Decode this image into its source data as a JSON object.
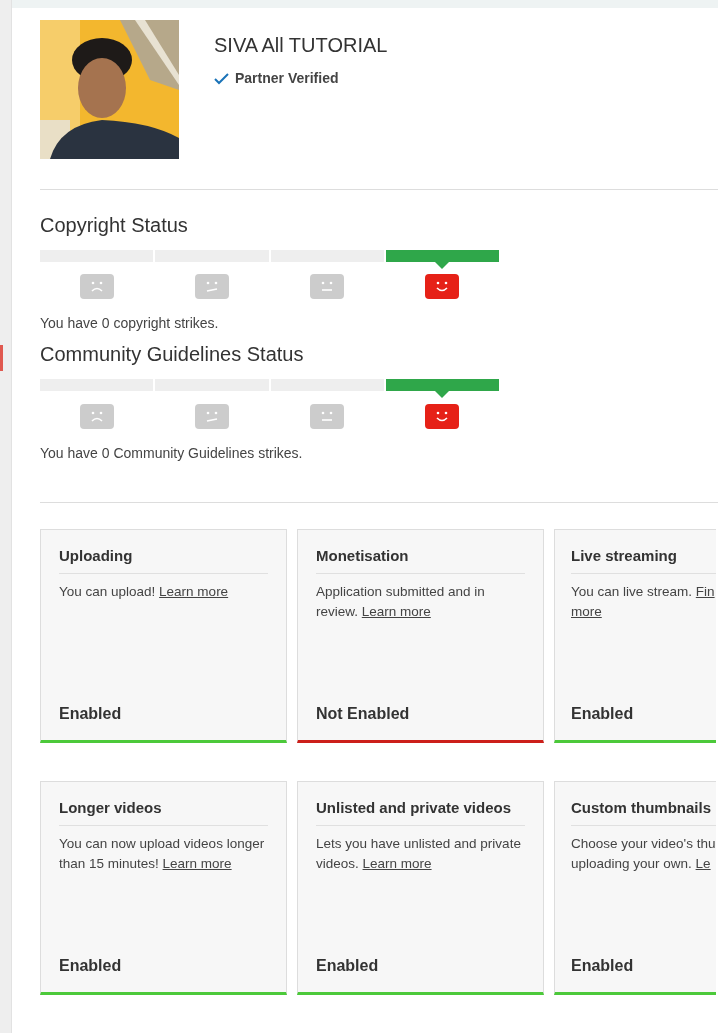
{
  "channel": {
    "name": "SIVA All TUTORIAL",
    "badge": "Partner Verified"
  },
  "statuses": [
    {
      "title": "Copyright Status",
      "segments": [
        {
          "selected": false
        },
        {
          "selected": false
        },
        {
          "selected": false
        },
        {
          "selected": true
        }
      ],
      "message": "You have 0 copyright strikes."
    },
    {
      "title": "Community Guidelines Status",
      "segments": [
        {
          "selected": false
        },
        {
          "selected": false
        },
        {
          "selected": false
        },
        {
          "selected": true
        }
      ],
      "message": "You have 0 Community Guidelines strikes."
    }
  ],
  "features": [
    {
      "title": "Uploading",
      "body": [
        {
          "text": "You can upload! "
        },
        {
          "text": "Learn more",
          "kind": "link"
        }
      ],
      "status": "Enabled",
      "enabled": true
    },
    {
      "title": "Monetisation",
      "body": [
        {
          "text": "Application submitted and in review. "
        },
        {
          "text": "Learn more",
          "kind": "link"
        }
      ],
      "status": "Not Enabled",
      "enabled": false
    },
    {
      "title": "Live streaming",
      "body": [
        {
          "text": "You can live stream. "
        },
        {
          "text": "Fin",
          "kind": "link"
        },
        {
          "kind": "break"
        },
        {
          "text": "more",
          "kind": "link"
        }
      ],
      "status": "Enabled",
      "enabled": true
    },
    {
      "title": "Longer videos",
      "body": [
        {
          "text": "You can now upload videos longer than 15 minutes! "
        },
        {
          "text": "Learn more",
          "kind": "link"
        }
      ],
      "status": "Enabled",
      "enabled": true
    },
    {
      "title": "Unlisted and private videos",
      "body": [
        {
          "text": "Lets you have unlisted and private videos. "
        },
        {
          "text": "Learn more",
          "kind": "link"
        }
      ],
      "status": "Enabled",
      "enabled": true
    },
    {
      "title": "Custom thumbnails",
      "body": [
        {
          "text": "Choose your video's thu"
        },
        {
          "kind": "break"
        },
        {
          "text": "uploading your own. "
        },
        {
          "text": "Le",
          "kind": "link"
        }
      ],
      "status": "Enabled",
      "enabled": true
    }
  ]
}
